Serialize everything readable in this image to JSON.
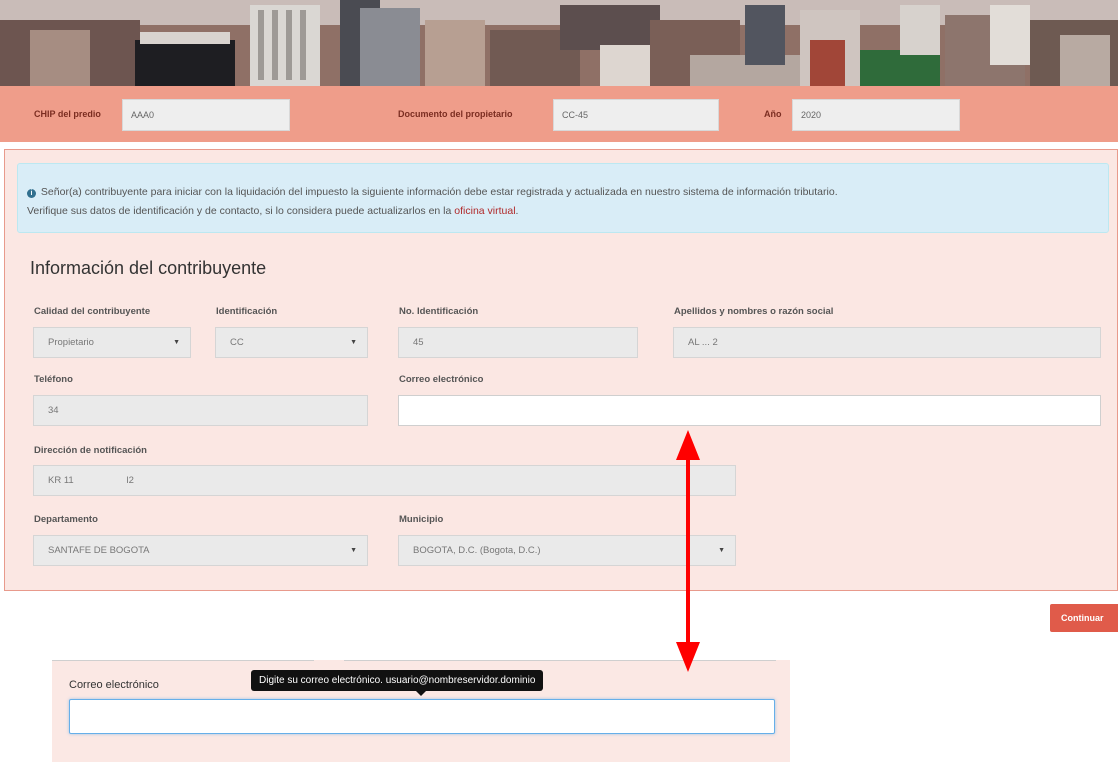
{
  "query": {
    "chip_label": "CHIP del predio",
    "chip_value": "AAA0",
    "doc_label": "Documento del propietario",
    "doc_value": "CC-45",
    "year_label": "Año",
    "year_value": "2020"
  },
  "notice": {
    "icon": "info-circle-icon",
    "text_1": "Señor(a) contribuyente para iniciar con la liquidación del impuesto la siguiente información debe estar registrada y actualizada en nuestro sistema de información tributario.",
    "text_2": "Verifique sus datos de identificación y de contacto, si lo considera puede actualizarlos en la ",
    "link": "oficina virtual",
    "text_3": "."
  },
  "form": {
    "title": "Información del contribuyente",
    "quality_label": "Calidad del contribuyente",
    "quality_value": "Propietario",
    "id_type_label": "Identificación",
    "id_type_value": "CC",
    "id_number_label": "No. Identificación",
    "id_number_value": "45",
    "name_label": "Apellidos y nombres o razón social",
    "name_value": "AL ... 2",
    "phone_label": "Teléfono",
    "phone_value": "34",
    "email_label": "Correo electrónico",
    "email_value": "",
    "address_label": "Dirección de notificación",
    "address_value": "KR 11                    l2",
    "dept_label": "Departamento",
    "dept_value": "SANTAFE DE BOGOTA",
    "muni_label": "Municipio",
    "muni_value": "BOGOTA, D.C. (Bogota, D.C.)"
  },
  "actions": {
    "continue_label": "Continuar"
  },
  "zoom": {
    "label": "Correo electrónico",
    "tooltip": "Digite su correo electrónico. usuario@nombreservidor.dominio",
    "value": ""
  },
  "colors": {
    "query_bar": "#ef9d8a",
    "panel": "#fbe7e3",
    "notice": "#d9edf7",
    "accent": "#e05b4a",
    "arrow": "#ff0000"
  }
}
